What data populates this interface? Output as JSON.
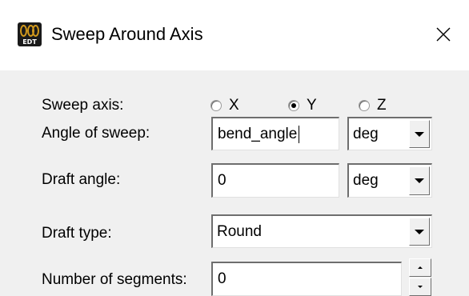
{
  "window": {
    "title": "Sweep Around Axis",
    "app_icon_text": "EDT",
    "icons": {
      "app": "edt-logo-icon",
      "close": "close-icon"
    }
  },
  "form": {
    "sweep_axis": {
      "label": "Sweep axis:",
      "options": [
        "X",
        "Y",
        "Z"
      ],
      "selected": "Y"
    },
    "angle_of_sweep": {
      "label": "Angle of sweep:",
      "value": "bend_angle",
      "unit": "deg"
    },
    "draft_angle": {
      "label": "Draft angle:",
      "value": "0",
      "unit": "deg"
    },
    "draft_type": {
      "label": "Draft type:",
      "value": "Round"
    },
    "number_of_segments": {
      "label": "Number of segments:",
      "value": "0"
    }
  },
  "colors": {
    "dialog_background": "#f0f0f0",
    "title_bar": "#ffffff",
    "field_background": "#ffffff",
    "logo_accent": "#d39a1d"
  }
}
